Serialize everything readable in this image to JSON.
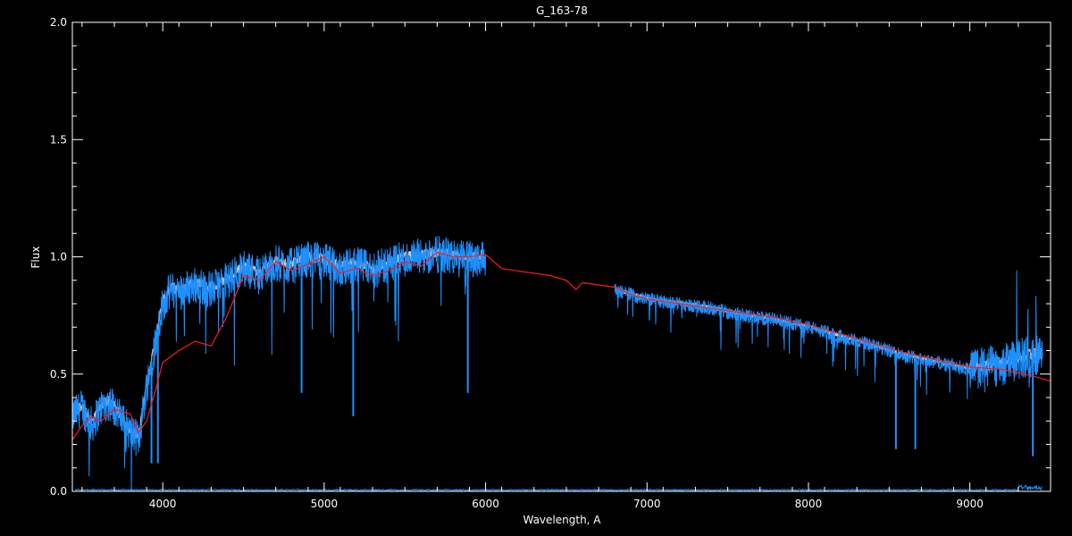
{
  "chart_data": {
    "type": "line",
    "title": "G_163-78",
    "xlabel": "Wavelength, A",
    "ylabel": "Flux",
    "xlim": [
      3440,
      9500
    ],
    "ylim": [
      0.0,
      2.0
    ],
    "x_ticks": [
      4000,
      5000,
      6000,
      7000,
      8000,
      9000
    ],
    "y_ticks": [
      0.0,
      0.5,
      1.0,
      1.5,
      2.0
    ],
    "y_tick_labels": [
      "0.0",
      "0.5",
      "1.0",
      "1.5",
      "2.0"
    ],
    "grid": false,
    "background": "#000000",
    "series": [
      {
        "role": "observed",
        "color": "#1e90ff",
        "segments": [
          {
            "x": [
              3440,
              3500,
              3560,
              3620,
              3680,
              3750,
              3800,
              3850,
              3900,
              3950,
              4000,
              4050,
              4100,
              4200,
              4300,
              4400,
              4500,
              4600,
              4700,
              4800,
              4900,
              5000,
              5100,
              5200,
              5300,
              5400,
              5500,
              5600,
              5700,
              5800,
              5900,
              6000
            ],
            "y": [
              0.32,
              0.36,
              0.28,
              0.36,
              0.38,
              0.3,
              0.25,
              0.22,
              0.45,
              0.62,
              0.8,
              0.86,
              0.85,
              0.88,
              0.86,
              0.9,
              0.95,
              0.93,
              0.97,
              0.96,
              0.99,
              0.98,
              0.95,
              0.97,
              0.94,
              0.97,
              0.99,
              1.0,
              1.01,
              1.0,
              0.99,
              1.0
            ]
          },
          {
            "x": [
              6800,
              7000,
              7200,
              7400,
              7600,
              7800,
              8000,
              8200,
              8400,
              8600,
              8800,
              9000,
              9200,
              9300,
              9400,
              9450
            ],
            "y": [
              0.86,
              0.82,
              0.8,
              0.78,
              0.75,
              0.73,
              0.7,
              0.66,
              0.62,
              0.58,
              0.55,
              0.52,
              0.54,
              0.56,
              0.58,
              0.57
            ]
          }
        ],
        "noise_series": {
          "x": [
            3440,
            9450
          ],
          "y": [
            0.0,
            0.0
          ]
        }
      },
      {
        "role": "model",
        "color": "#ff1a1a",
        "x": [
          3440,
          3500,
          3560,
          3620,
          3700,
          3800,
          3850,
          3900,
          3950,
          4000,
          4100,
          4200,
          4300,
          4400,
          4500,
          4600,
          4700,
          4800,
          4900,
          5000,
          5100,
          5200,
          5300,
          5400,
          5500,
          5600,
          5700,
          5800,
          5900,
          6000,
          6050,
          6100,
          6200,
          6300,
          6400,
          6500,
          6560,
          6600,
          6700,
          6800,
          6900,
          7000,
          7200,
          7400,
          7600,
          7800,
          8000,
          8200,
          8400,
          8600,
          8800,
          9000,
          9200,
          9400,
          9500
        ],
        "y": [
          0.22,
          0.28,
          0.32,
          0.3,
          0.35,
          0.33,
          0.25,
          0.3,
          0.42,
          0.55,
          0.6,
          0.64,
          0.62,
          0.75,
          0.92,
          0.9,
          0.98,
          0.94,
          0.97,
          1.0,
          0.93,
          0.95,
          0.92,
          0.94,
          0.98,
          0.96,
          1.02,
          1.0,
          1.0,
          1.01,
          0.98,
          0.95,
          0.94,
          0.93,
          0.92,
          0.9,
          0.86,
          0.89,
          0.88,
          0.87,
          0.84,
          0.82,
          0.8,
          0.78,
          0.76,
          0.74,
          0.71,
          0.67,
          0.63,
          0.59,
          0.56,
          0.53,
          0.52,
          0.49,
          0.47
        ]
      }
    ]
  }
}
